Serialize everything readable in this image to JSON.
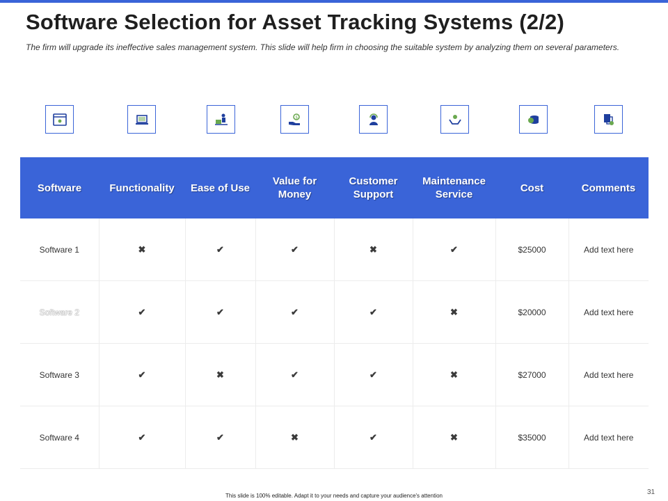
{
  "header": {
    "title": "Software Selection for Asset Tracking Systems (2/2)",
    "subtitle": "The firm will upgrade its ineffective sales management system. This slide will help firm in choosing the suitable system by analyzing them on several parameters."
  },
  "icons": [
    {
      "name": "browser-settings-icon"
    },
    {
      "name": "laptop-icon"
    },
    {
      "name": "person-at-desk-icon"
    },
    {
      "name": "money-in-hand-icon"
    },
    {
      "name": "customer-support-icon"
    },
    {
      "name": "maintenance-care-icon"
    },
    {
      "name": "coins-stack-icon"
    },
    {
      "name": "document-settings-icon"
    }
  ],
  "table": {
    "headers": [
      "Software",
      "Functionality",
      "Ease of Use",
      "Value for Money",
      "Customer Support",
      "Maintenance Service",
      "Cost",
      "Comments"
    ],
    "rows": [
      {
        "software": "Software 1",
        "functionality": "✖",
        "ease": "✔",
        "value": "✔",
        "support": "✖",
        "maintenance": "✔",
        "cost": "$25000",
        "comments": "Add text here"
      },
      {
        "software": "Software 2",
        "functionality": "✔",
        "ease": "✔",
        "value": "✔",
        "support": "✔",
        "maintenance": "✖",
        "cost": "$20000",
        "comments": "Add text here"
      },
      {
        "software": "Software 3",
        "functionality": "✔",
        "ease": "✖",
        "value": "✔",
        "support": "✔",
        "maintenance": "✖",
        "cost": "$27000",
        "comments": "Add text here"
      },
      {
        "software": "Software 4",
        "functionality": "✔",
        "ease": "✔",
        "value": "✖",
        "support": "✔",
        "maintenance": "✖",
        "cost": "$35000",
        "comments": "Add text here"
      }
    ]
  },
  "footer": {
    "note": "This slide is 100% editable. Adapt it to your needs and capture your audience's attention",
    "page_number": "31"
  },
  "colors": {
    "accent": "#3a64d8",
    "icon_dark": "#1f3f9e",
    "icon_green": "#6aa84f"
  }
}
